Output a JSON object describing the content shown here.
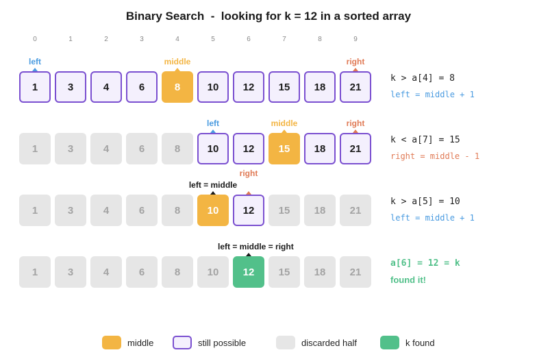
{
  "title": "Binary Search  -  looking for k = 12 in a sorted array",
  "indices": [
    "0",
    "1",
    "2",
    "3",
    "4",
    "5",
    "6",
    "7",
    "8",
    "9"
  ],
  "colors": {
    "middle": "#f3b543",
    "still_possible_border": "#7a4fd0",
    "discarded": "#e6e6e6",
    "found": "#52c08a",
    "left": "#4a9be0",
    "right": "#e07a55"
  },
  "steps": [
    {
      "values": [
        "1",
        "3",
        "4",
        "6",
        "8",
        "10",
        "12",
        "15",
        "18",
        "21"
      ],
      "states": [
        "possible",
        "possible",
        "possible",
        "possible",
        "middle",
        "possible",
        "possible",
        "possible",
        "possible",
        "possible"
      ],
      "pointers": [
        {
          "label": "left",
          "cell": 0,
          "kind": "left"
        },
        {
          "label": "middle",
          "cell": 4,
          "kind": "middle"
        },
        {
          "label": "right",
          "cell": 9,
          "kind": "right"
        }
      ],
      "comparison": "k > a[4] = 8",
      "action": "left = middle + 1",
      "action_kind": "left"
    },
    {
      "values": [
        "1",
        "3",
        "4",
        "6",
        "8",
        "10",
        "12",
        "15",
        "18",
        "21"
      ],
      "states": [
        "discarded",
        "discarded",
        "discarded",
        "discarded",
        "discarded",
        "possible",
        "possible",
        "middle",
        "possible",
        "possible"
      ],
      "pointers": [
        {
          "label": "left",
          "cell": 5,
          "kind": "left"
        },
        {
          "label": "middle",
          "cell": 7,
          "kind": "middle"
        },
        {
          "label": "right",
          "cell": 9,
          "kind": "right"
        }
      ],
      "comparison": "k < a[7] = 15",
      "action": "right = middle - 1",
      "action_kind": "right"
    },
    {
      "values": [
        "1",
        "3",
        "4",
        "6",
        "8",
        "10",
        "12",
        "15",
        "18",
        "21"
      ],
      "states": [
        "discarded",
        "discarded",
        "discarded",
        "discarded",
        "discarded",
        "middle",
        "possible",
        "discarded",
        "discarded",
        "discarded"
      ],
      "pointers": [
        {
          "label": "left = middle",
          "cell": 5,
          "kind": "dark"
        },
        {
          "label": "right",
          "cell": 6,
          "kind": "right",
          "raised": true
        }
      ],
      "comparison": "k > a[5] = 10",
      "action": "left = middle + 1",
      "action_kind": "left"
    },
    {
      "values": [
        "1",
        "3",
        "4",
        "6",
        "8",
        "10",
        "12",
        "15",
        "18",
        "21"
      ],
      "states": [
        "discarded",
        "discarded",
        "discarded",
        "discarded",
        "discarded",
        "discarded",
        "found",
        "discarded",
        "discarded",
        "discarded"
      ],
      "pointers": [
        {
          "label": "left = middle = right",
          "cell": 6,
          "kind": "dark"
        }
      ],
      "comparison": "a[6] = 12 = k",
      "action": "found it!",
      "action_kind": "found"
    }
  ],
  "legend": [
    {
      "label": "middle",
      "kind": "middle"
    },
    {
      "label": "still possible",
      "kind": "possible"
    },
    {
      "label": "discarded half",
      "kind": "discarded"
    },
    {
      "label": "k found",
      "kind": "found"
    }
  ]
}
